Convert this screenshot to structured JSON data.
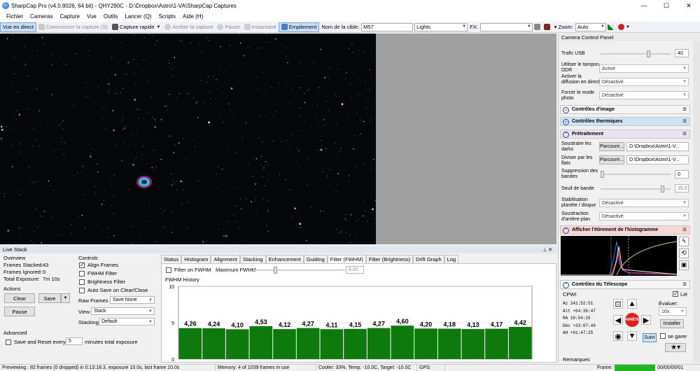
{
  "window": {
    "title": "SharpCap Pro (v4.0.8026, 64 bit) - QHY290C - D:\\Dropbox\\Astro\\1-VA\\SharpCap Captures",
    "min": "—",
    "max": "☐",
    "close": "✕"
  },
  "menu": [
    "Fichier",
    "Cameras",
    "Capture",
    "Vue",
    "Outils",
    "Lancer (Q)",
    "Scripts",
    "Aide (H)"
  ],
  "toolbar": {
    "live_view": "Vue en direct",
    "start_capture": "Commencer la capture (S)",
    "quick_capture": "Capture rapide",
    "stop_capture": "Arrêter la capture",
    "pause": "Pause",
    "snapshot": "Instantané",
    "stacking": "Empilement",
    "target_label": "Nom de la cible:",
    "target_value": "M57",
    "frame_type": "Lights",
    "fx_label": "FX:",
    "fx_value": "",
    "zoom_label": "Zoom:",
    "zoom_value": "Auto"
  },
  "camera_panel": {
    "title": "Camera Control Panel",
    "usb_label": "Trafic USB",
    "usb_value": "40",
    "ddr_label": "Utiliser le tampon DDR",
    "ddr_value": "Activé",
    "broadcast_label": "Activer la diffusion en direct",
    "broadcast_value": "Désactivé",
    "photo_mode_label": "Forcer le mode photo",
    "photo_mode_value": "Désactivé",
    "image_controls": "Contrôles d'image",
    "thermal_controls": "Contrôles thermiques",
    "preprocessing": "Prétraitement",
    "subtract_darks_label": "Soustraire les darks",
    "browse": "Parcourir...",
    "darks_path": "D:\\Dropbox\\Astro\\1-V...",
    "divide_flats_label": "Diviser par les flats",
    "flats_path": "D:\\Dropbox\\Astro\\1-V...",
    "banding_label": "Suppression des bandes",
    "banding_value": "0",
    "band_threshold_label": "Seuil de bande",
    "band_threshold_value": "35.0",
    "stabilization_label": "Stabilisation planète / disque",
    "stabilization_value": "Désactivé",
    "bg_subtract_label": "Soustraction d'arrière-plan",
    "bg_subtract_value": "Désactivé",
    "histogram_stretch": "Afficher l'étirement de l'histogramme",
    "telescope_controls": "Contrôles du Télescope",
    "telescope_name": "CPWI",
    "linked_label": "Lié",
    "evaluate_label": "Évaluer:",
    "evaluate_value": "16x",
    "install": "Installer",
    "park_label": "se garer",
    "follow": "Suivi",
    "stop": "ARRÊTE",
    "remarks": "Remarques",
    "frame_label": "Frame:",
    "coords": [
      {
        "k": "Az",
        "v": "241:52:51"
      },
      {
        "k": "Alt",
        "v": "+64:36:47"
      },
      {
        "k": "RA",
        "v": "18:54:15"
      },
      {
        "k": "Déc",
        "v": "+33:07:49"
      },
      {
        "k": "AH",
        "v": "+01:47:25"
      }
    ]
  },
  "live_stack": {
    "title": "Live Stack",
    "overview": "Overview",
    "frames_stacked_label": "Frames Stacked:",
    "frames_stacked": "43",
    "frames_ignored_label": "Frames Ignored:",
    "frames_ignored": "0",
    "total_exposure_label": "Total Exposure:",
    "total_exposure": "7m 10s",
    "actions": "Actions",
    "clear": "Clear",
    "save": "Save",
    "pause": "Pause",
    "controls": "Controls",
    "align_frames": "Align Frames",
    "fwhm_filter": "FWHM Filter",
    "brightness_filter": "Brightness Filter",
    "auto_save": "Auto Save on Clear/Close",
    "raw_frames_label": "Raw Frames",
    "raw_frames_value": "Save None",
    "view_label": "View",
    "view_value": "Stack",
    "stacking_label": "Stacking",
    "stacking_value": "Default",
    "advanced": "Advanced",
    "save_reset_label": "Save and Reset every",
    "save_reset_value": "5",
    "minutes_label": "minutes total exposure",
    "tabs": [
      "Status",
      "Histogram",
      "Alignment",
      "Stacking",
      "Enhancement",
      "Guiding",
      "Filter (FWHM)",
      "Filter (Brightness)",
      "Drift Graph",
      "Log"
    ],
    "selected_tab": 6,
    "filter_on_fwhm": "Filter on FWHM",
    "max_fwhm_label": "Maximum FWHM",
    "max_fwhm_value": "4.00"
  },
  "chart_data": {
    "type": "bar",
    "title": "FWHM History",
    "values": [
      4.26,
      4.24,
      4.1,
      4.53,
      4.12,
      4.27,
      4.11,
      4.15,
      4.27,
      4.6,
      4.2,
      4.18,
      4.13,
      4.17,
      4.42
    ],
    "value_labels": [
      "4,26",
      "4,24",
      "4,10",
      "4,53",
      "4,12",
      "4,27",
      "4,11",
      "4,15",
      "4,27",
      "4,60",
      "4,20",
      "4,18",
      "4,13",
      "4,17",
      "4,42"
    ],
    "yticks": [
      "10",
      "5",
      "0"
    ],
    "ylim": [
      0,
      10
    ],
    "grid": true,
    "bar_color": "#0e7a0e"
  },
  "status": {
    "previewing": "Previewing : 82 frames (0 dropped) in 0:13:18.3, exposure 10.0s, last frame 10.0s",
    "memory": "Memory: 4 of 1039 frames in use",
    "cooler": "Cooler: 33%, Temp: -10.0C, Target: -10.0C",
    "gps": "GPS:",
    "time": "00/00/00/01"
  }
}
